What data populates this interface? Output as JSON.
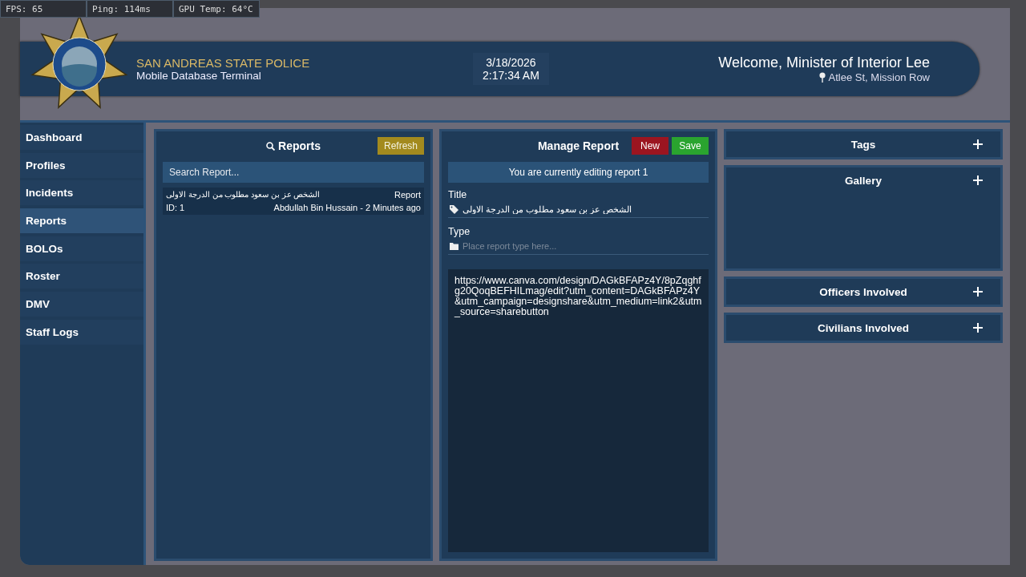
{
  "overlay": {
    "stats": [
      "FPS: 65",
      "Ping: 114ms",
      "GPU Temp: 64°C"
    ]
  },
  "header": {
    "agency": "SAN ANDREAS STATE POLICE",
    "subtitle": "Mobile Database Terminal",
    "date": "3/18/2026",
    "time": "2:17:34 AM",
    "welcome": "Welcome, Minister of Interior Lee",
    "location": "Atlee St, Mission Row"
  },
  "sidebar": {
    "items": [
      {
        "label": "Dashboard",
        "selected": false
      },
      {
        "label": "Profiles",
        "selected": false
      },
      {
        "label": "Incidents",
        "selected": false
      },
      {
        "label": "Reports",
        "selected": true
      },
      {
        "label": "BOLOs",
        "selected": false
      },
      {
        "label": "Roster",
        "selected": false
      },
      {
        "label": "DMV",
        "selected": false
      },
      {
        "label": "Staff Logs",
        "selected": false
      }
    ]
  },
  "reports": {
    "title": "Reports",
    "refresh": "Refresh",
    "search": {
      "placeholder": "Search Report..."
    },
    "items": [
      {
        "title": "الشخص عز بن سعود مطلوب من الدرجة الاولى",
        "type": "Report",
        "id": "ID: 1",
        "author": "Abdullah Bin Hussain - 2 Minutes ago"
      }
    ]
  },
  "manage": {
    "title": "Manage Report",
    "buttons": [
      {
        "label": "New",
        "kind": "danger"
      },
      {
        "label": "Save",
        "kind": "success"
      }
    ],
    "notice": "You are currently editing report 1",
    "fields": [
      {
        "label": "Title",
        "kind": "tag",
        "value": "الشخص عز بن سعود مطلوب من الدرجة الاولى"
      },
      {
        "label": "Type",
        "kind": "folder",
        "placeholder": "Place report type here..."
      }
    ],
    "body": "https://www.canva.com/design/DAGkBFAPz4Y/8pZqghfg20QoqBEFHILmag/edit?utm_content=DAGkBFAPz4Y&utm_campaign=designshare&utm_medium=link2&utm_source=sharebutton"
  },
  "sections": [
    {
      "title": "Tags",
      "kind": "list"
    },
    {
      "title": "Gallery",
      "kind": "gallery"
    },
    {
      "title": "Officers Involved",
      "kind": "list"
    },
    {
      "title": "Civilians Involved",
      "kind": "list"
    }
  ]
}
